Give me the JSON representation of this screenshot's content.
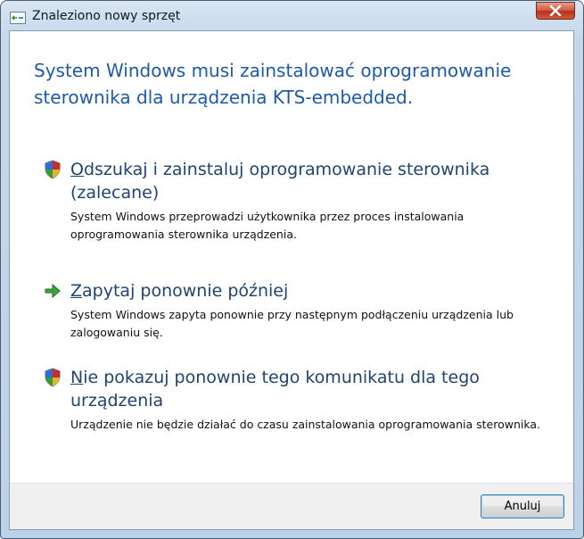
{
  "window": {
    "title": "Znaleziono nowy sprzęt"
  },
  "header": {
    "text": "System Windows musi zainstalować oprogramowanie sterownika dla urządzenia KTS-embedded."
  },
  "options": [
    {
      "icon": "shield-icon",
      "access_key": "O",
      "title_rest": "dszukaj i zainstaluj oprogramowanie sterownika (zalecane)",
      "description": "System Windows przeprowadzi użytkownika przez proces instalowania oprogramowania sterownika urządzenia."
    },
    {
      "icon": "green-arrow-icon",
      "access_key": "Z",
      "title_rest": "apytaj ponownie później",
      "description": "System Windows zapyta ponownie przy następnym podłączeniu urządzenia lub zalogowaniu się."
    },
    {
      "icon": "shield-icon",
      "access_key": "N",
      "title_rest": "ie pokazuj ponownie tego komunikatu dla tego urządzenia",
      "description": "Urządzenie nie będzie działać do czasu zainstalowania oprogramowania sterownika."
    }
  ],
  "footer": {
    "cancel_label": "Anuluj"
  },
  "colors": {
    "header_text": "#1e5aa8",
    "option_title": "#1f4470",
    "close_button": "#c8452c"
  }
}
